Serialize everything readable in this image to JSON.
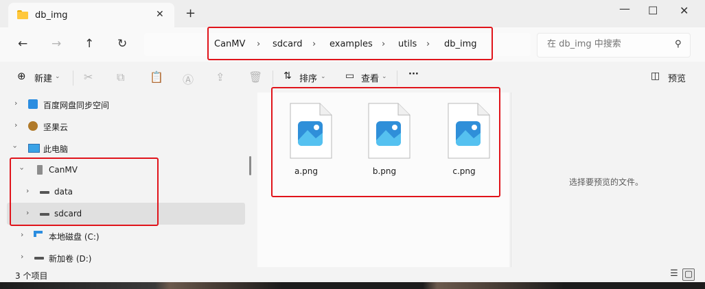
{
  "window": {
    "tab_title": "db_img",
    "new_tab_icon": "plus-icon",
    "controls": [
      "minimize-icon",
      "maximize-icon",
      "close-icon"
    ]
  },
  "address": {
    "crumbs": [
      "CanMV",
      "sdcard",
      "examples",
      "utils",
      "db_img"
    ],
    "search_placeholder": "在 db_img 中搜索"
  },
  "commands": {
    "new_label": "新建",
    "sort_label": "排序",
    "view_label": "查看",
    "more_label": "···",
    "preview_label": "预览"
  },
  "nav": {
    "items": [
      {
        "label": "百度网盘同步空间",
        "icon": "cloud-sync-icon"
      },
      {
        "label": "坚果云",
        "icon": "nut-icon"
      },
      {
        "label": "此电脑",
        "icon": "monitor-icon"
      },
      {
        "label": "CanMV",
        "icon": "usb-drive-icon"
      },
      {
        "label": "data",
        "icon": "drive-icon"
      },
      {
        "label": "sdcard",
        "icon": "drive-icon"
      },
      {
        "label": "本地磁盘 (C:)",
        "icon": "windows-drive-icon"
      },
      {
        "label": "新加卷 (D:)",
        "icon": "drive-icon"
      }
    ]
  },
  "files": [
    {
      "name": "a.png"
    },
    {
      "name": "b.png"
    },
    {
      "name": "c.png"
    }
  ],
  "preview": {
    "empty_text": "选择要预览的文件。"
  },
  "status": {
    "item_count": "3 个项目"
  },
  "colors": {
    "highlight": "#e0131a",
    "folder": "#ffc83d",
    "image_icon_start": "#2f8fd9",
    "image_icon_end": "#55c1f0"
  }
}
